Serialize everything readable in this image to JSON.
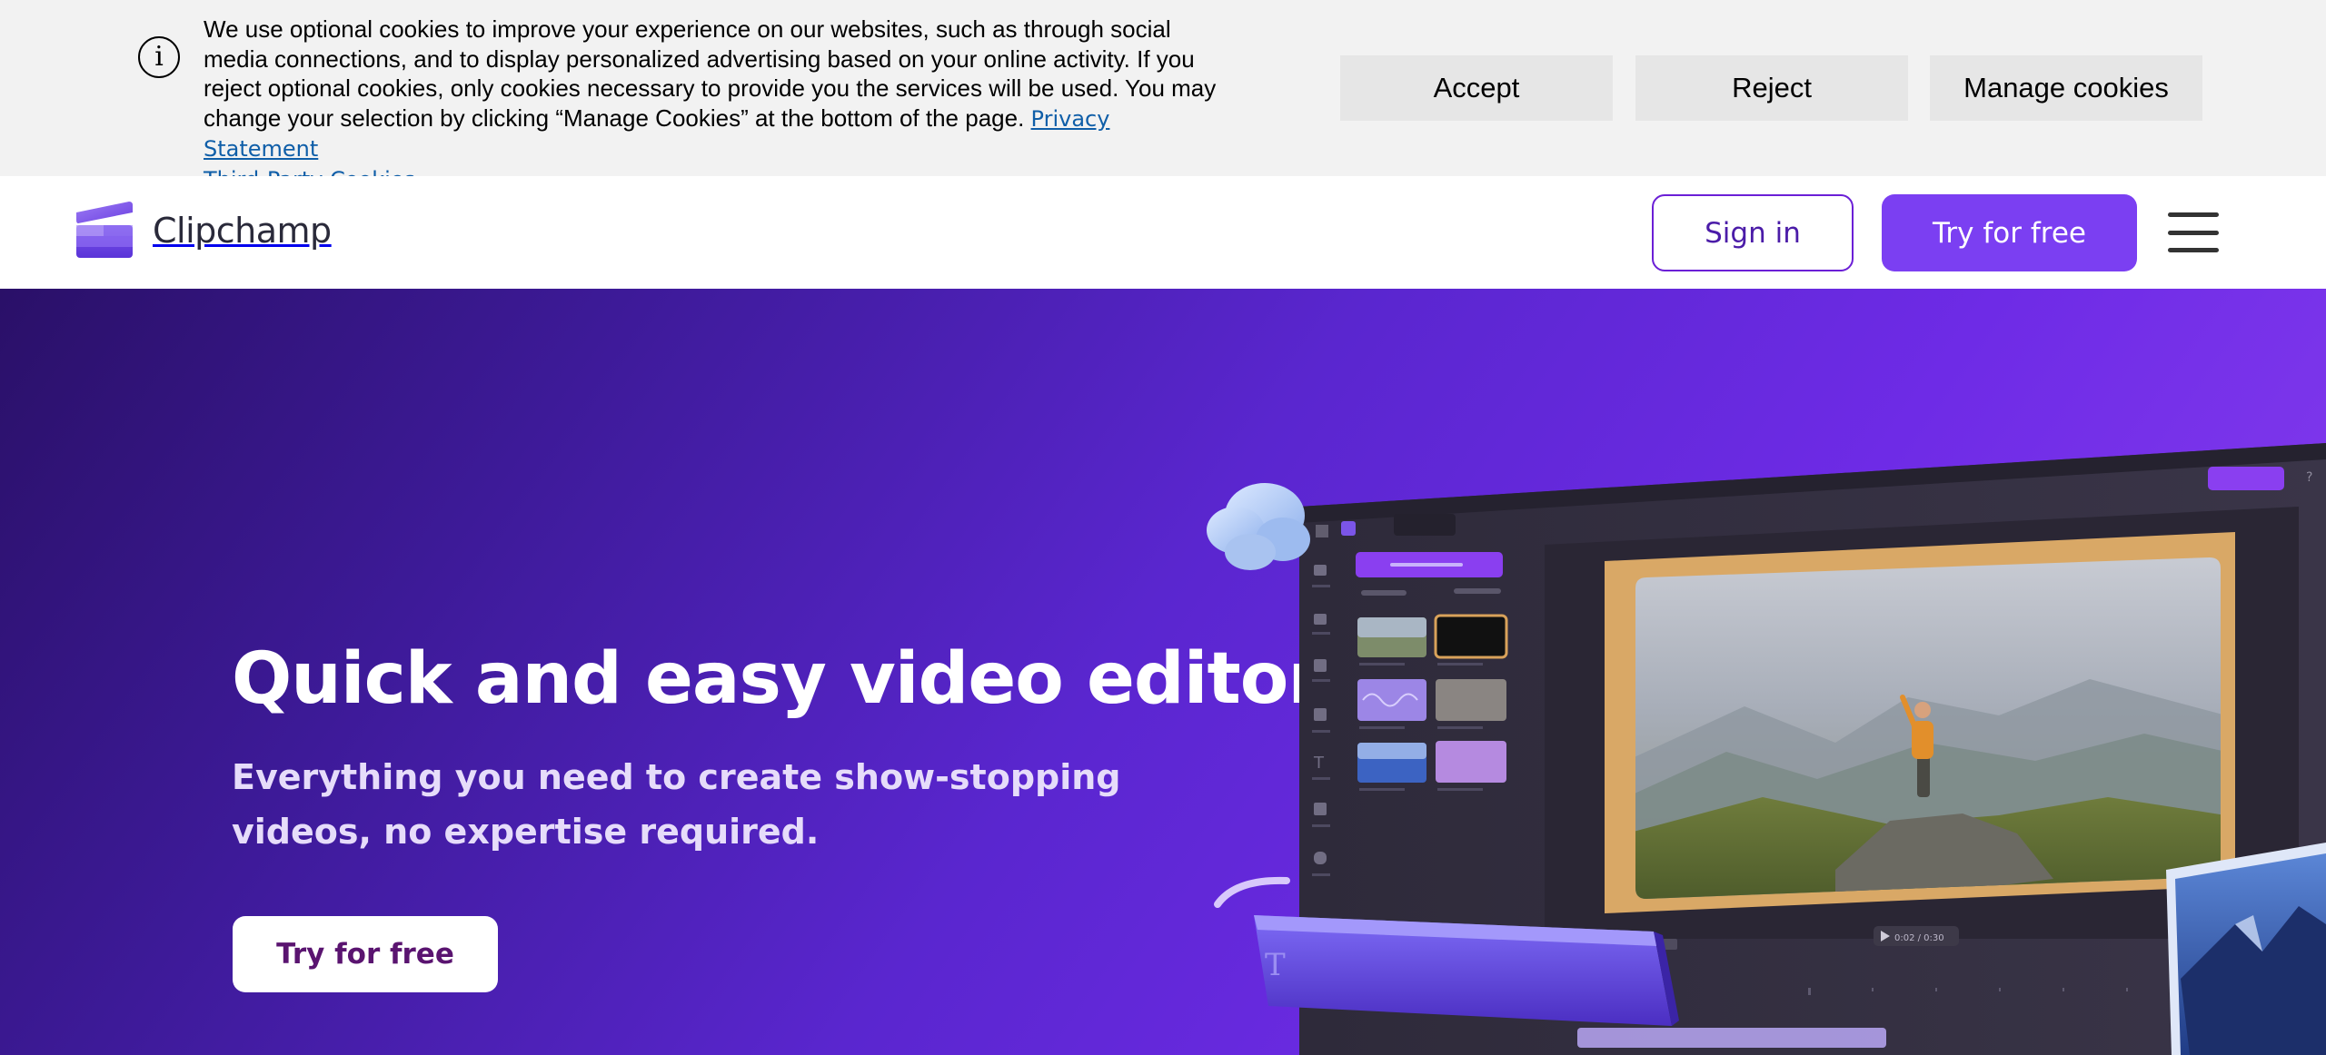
{
  "cookie_banner": {
    "message": "We use optional cookies to improve your experience on our websites, such as through social media connections, and to display personalized advertising based on your online activity. If you reject optional cookies, only cookies necessary to provide you the services will be used. You may change your selection by clicking “Manage Cookies” at the bottom of the page.",
    "privacy_link": "Privacy Statement",
    "third_party_link": "Third-Party Cookies",
    "accept_label": "Accept",
    "reject_label": "Reject",
    "manage_label": "Manage cookies",
    "info_icon": "info-icon"
  },
  "header": {
    "logo_text": "Clipchamp",
    "sign_in_label": "Sign in",
    "try_label": "Try for free",
    "menu_icon": "hamburger-menu-icon",
    "accent_color": "#7b3ff2"
  },
  "hero": {
    "title": "Quick and easy video editor",
    "subtitle": "Everything you need to create show-stopping videos, no expertise required.",
    "cta_label": "Try for free",
    "editor_time": "0:02 / 0:30",
    "text_tool_glyph": "T"
  }
}
